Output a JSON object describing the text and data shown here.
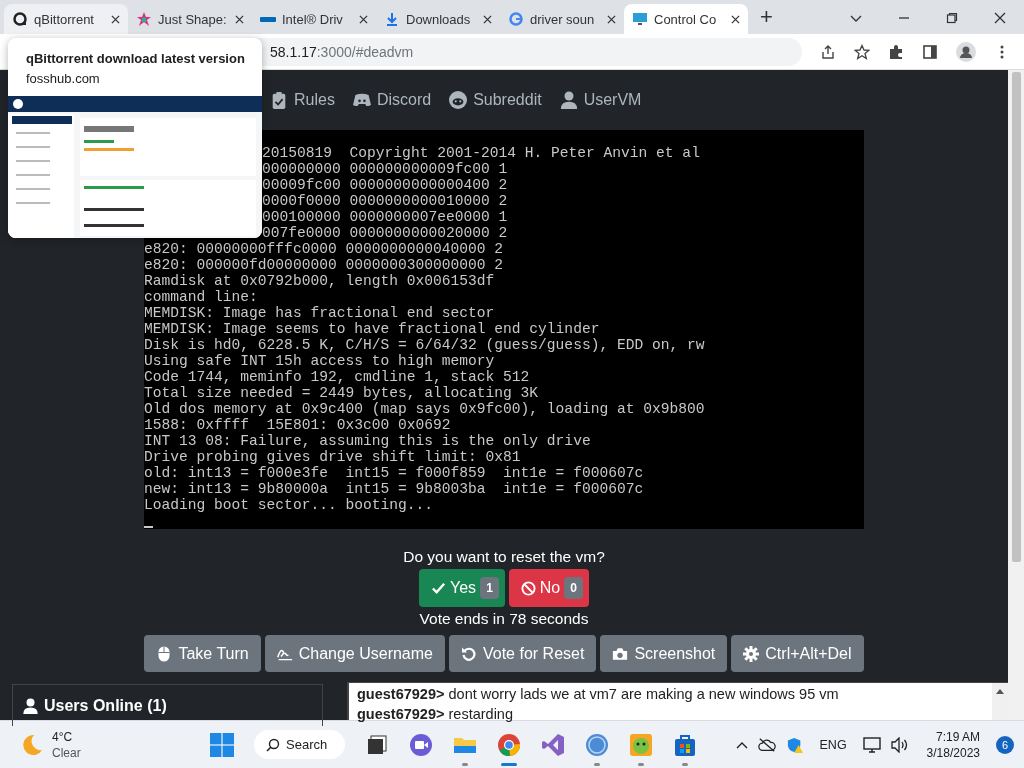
{
  "browser": {
    "tabs": [
      {
        "title": "qBittorrent",
        "selected": false,
        "hovered": true
      },
      {
        "title": "Just Shape:",
        "selected": false,
        "hovered": false
      },
      {
        "title": "Intel® Driv",
        "selected": false,
        "hovered": false
      },
      {
        "title": "Downloads",
        "selected": false,
        "hovered": false
      },
      {
        "title": "driver soun",
        "selected": false,
        "hovered": false
      },
      {
        "title": "Control Co",
        "selected": true,
        "hovered": false
      }
    ],
    "new_tab": "+",
    "url_host": "58.1.17",
    "url_path": ":3000/#deadvm",
    "tooltip": {
      "title": "qBittorrent download latest version",
      "domain": "fosshub.com"
    }
  },
  "navbar": [
    "Rules",
    "Discord",
    "Subreddit",
    "UserVM"
  ],
  "console": [
    {
      "kind": "partial",
      "text": "20150819  Copyright 2001-2014 H. Peter Anvin et al"
    },
    {
      "kind": "partial",
      "text": "000000000 000000000009fc00 1"
    },
    {
      "kind": "partial",
      "text": "00009fc00 0000000000000400 2"
    },
    {
      "kind": "partial",
      "text": "0000f0000 0000000000010000 2"
    },
    {
      "kind": "partial",
      "text": "000100000 0000000007ee0000 1"
    },
    {
      "kind": "partial",
      "text": "007fe0000 0000000000020000 2"
    },
    {
      "kind": "full",
      "text": "e820: 00000000fffc0000 0000000000040000 2"
    },
    {
      "kind": "full",
      "text": "e820: 000000fd00000000 0000000300000000 2"
    },
    {
      "kind": "full",
      "text": "Ramdisk at 0x0792b000, length 0x006153df"
    },
    {
      "kind": "full",
      "text": "command line:"
    },
    {
      "kind": "full",
      "text": "MEMDISK: Image has fractional end sector"
    },
    {
      "kind": "full",
      "text": "MEMDISK: Image seems to have fractional end cylinder"
    },
    {
      "kind": "full",
      "text": "Disk is hd0, 6228.5 K, C/H/S = 6/64/32 (guess/guess), EDD on, rw"
    },
    {
      "kind": "full",
      "text": "Using safe INT 15h access to high memory"
    },
    {
      "kind": "full",
      "text": "Code 1744, meminfo 192, cmdline 1, stack 512"
    },
    {
      "kind": "full",
      "text": "Total size needed = 2449 bytes, allocating 3K"
    },
    {
      "kind": "full",
      "text": "Old dos memory at 0x9c400 (map says 0x9fc00), loading at 0x9b800"
    },
    {
      "kind": "full",
      "text": "1588: 0xffff  15E801: 0x3c00 0x0692"
    },
    {
      "kind": "full",
      "text": "INT 13 08: Failure, assuming this is the only drive"
    },
    {
      "kind": "full",
      "text": "Drive probing gives drive shift limit: 0x81"
    },
    {
      "kind": "full",
      "text": "old: int13 = f000e3fe  int15 = f000f859  int1e = f000607c"
    },
    {
      "kind": "full",
      "text": "new: int13 = 9b80000a  int15 = 9b8003ba  int1e = f000607c"
    },
    {
      "kind": "full",
      "text": "Loading boot sector... booting..."
    }
  ],
  "vote": {
    "question": "Do you want to reset the vm?",
    "yes": {
      "label": "Yes",
      "count": "1"
    },
    "no": {
      "label": "No",
      "count": "0"
    },
    "ends": "Vote ends in 78 seconds"
  },
  "actions": [
    "Take Turn",
    "Change Username",
    "Vote for Reset",
    "Screenshot",
    "Ctrl+Alt+Del"
  ],
  "users_online": "Users Online (1)",
  "chat": [
    "**guest67929>** dont worry lads we at vm7 are making a new windows 95 vm",
    "**guest67929>** restarding"
  ],
  "taskbar": {
    "temperature": "4°C",
    "weather": "Clear",
    "search": "Search",
    "apps": [
      {
        "running": false
      },
      {
        "running": false
      },
      {
        "running": true
      },
      {
        "running": true
      },
      {
        "running": false
      },
      {
        "running": true
      },
      {
        "running": true
      },
      {
        "running": true
      }
    ],
    "language": "ENG",
    "time": "7:19 AM",
    "date": "3/18/2023",
    "notifications": "6"
  }
}
